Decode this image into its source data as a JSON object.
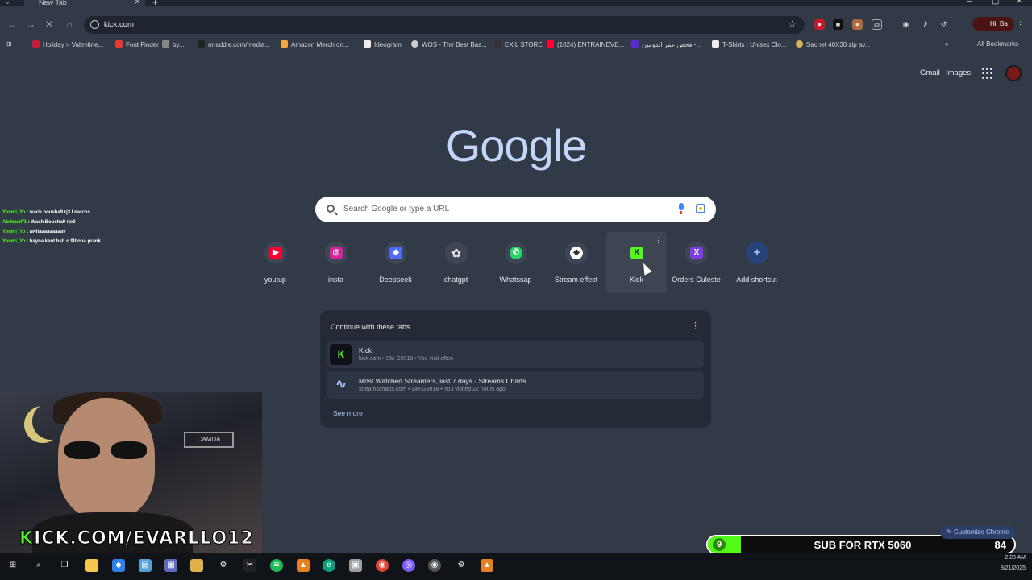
{
  "tab": {
    "title": "New Tab"
  },
  "omnibox": {
    "url": "kick.com"
  },
  "profile_chip": "Hi, Ba",
  "bookmarks": [
    "Holiday > Valentine...",
    "Font Finder",
    "by...",
    "mraddie.com/media...",
    "Amazon Merch on...",
    "Ideogram",
    "WOS - The Best Bas...",
    "EXIL STORE",
    "(1024) ENTRAINEVE...",
    "فحص عمر الدومين -...",
    "T-Shirts | Unisex Clo...",
    "Sachet 40X30 zip av...",
    "All Bookmarks"
  ],
  "header_links": {
    "gmail": "Gmail",
    "images": "Images"
  },
  "logo": "Google",
  "search": {
    "placeholder": "Search Google or type a URL"
  },
  "shortcuts": [
    {
      "label": "youtup",
      "icon": "youtube-icon",
      "color": "#ff0033"
    },
    {
      "label": "insta",
      "icon": "instagram-icon",
      "color": "#d6249f"
    },
    {
      "label": "Deepseek",
      "icon": "deepseek-icon",
      "color": "#4d6bfe"
    },
    {
      "label": "chatgpt",
      "icon": "chatgpt-icon",
      "color": "#3e4554"
    },
    {
      "label": "Whatssap",
      "icon": "whatsapp-icon",
      "color": "#25d366"
    },
    {
      "label": "Stream effect",
      "icon": "stream-effect-icon",
      "color": "#ffffff"
    },
    {
      "label": "Kick",
      "icon": "kick-icon",
      "color": "#53fc18"
    },
    {
      "label": "Orders Culeste",
      "icon": "culeste-icon",
      "color": "#7b3fe4"
    },
    {
      "label": "Add shortcut",
      "icon": "plus-icon",
      "color": "#a8c7fa"
    }
  ],
  "continue_card": {
    "title": "Continue with these tabs",
    "items": [
      {
        "title": "Kick",
        "subtitle": "kick.com • SM-G9918 • You visit often"
      },
      {
        "title": "Most Watched Streamers, last 7 days - Streams Charts",
        "subtitle": "streamscharts.com • SM-G9918 • You visited 22 hours ago"
      }
    ],
    "see_more": "See more"
  },
  "chat": [
    {
      "user": "Youmi_Yo",
      "msg": " : wach bousha9 rj3 l narcos"
    },
    {
      "user": "Abdouoff1",
      "msg": " : Wach Bousha9 rje3"
    },
    {
      "user": "Youmi_Yo",
      "msg": " : awilaaaaaaaaay"
    },
    {
      "user": "Youmi_Yo",
      "msg": " : bayna kant bsh o 9lboha prank"
    }
  ],
  "webcam": {
    "channel_k": "K",
    "channel_rest": "ICK.COM/EVARLLO12",
    "sign": "CAMDA"
  },
  "sub_goal": {
    "current": "9",
    "goal_text": "SUB FOR RTX 5060",
    "target": "84",
    "progress": 0.107
  },
  "customize": "Customize Chrome",
  "clock": {
    "time": "2:23 AM",
    "date": "8/21/2025"
  }
}
